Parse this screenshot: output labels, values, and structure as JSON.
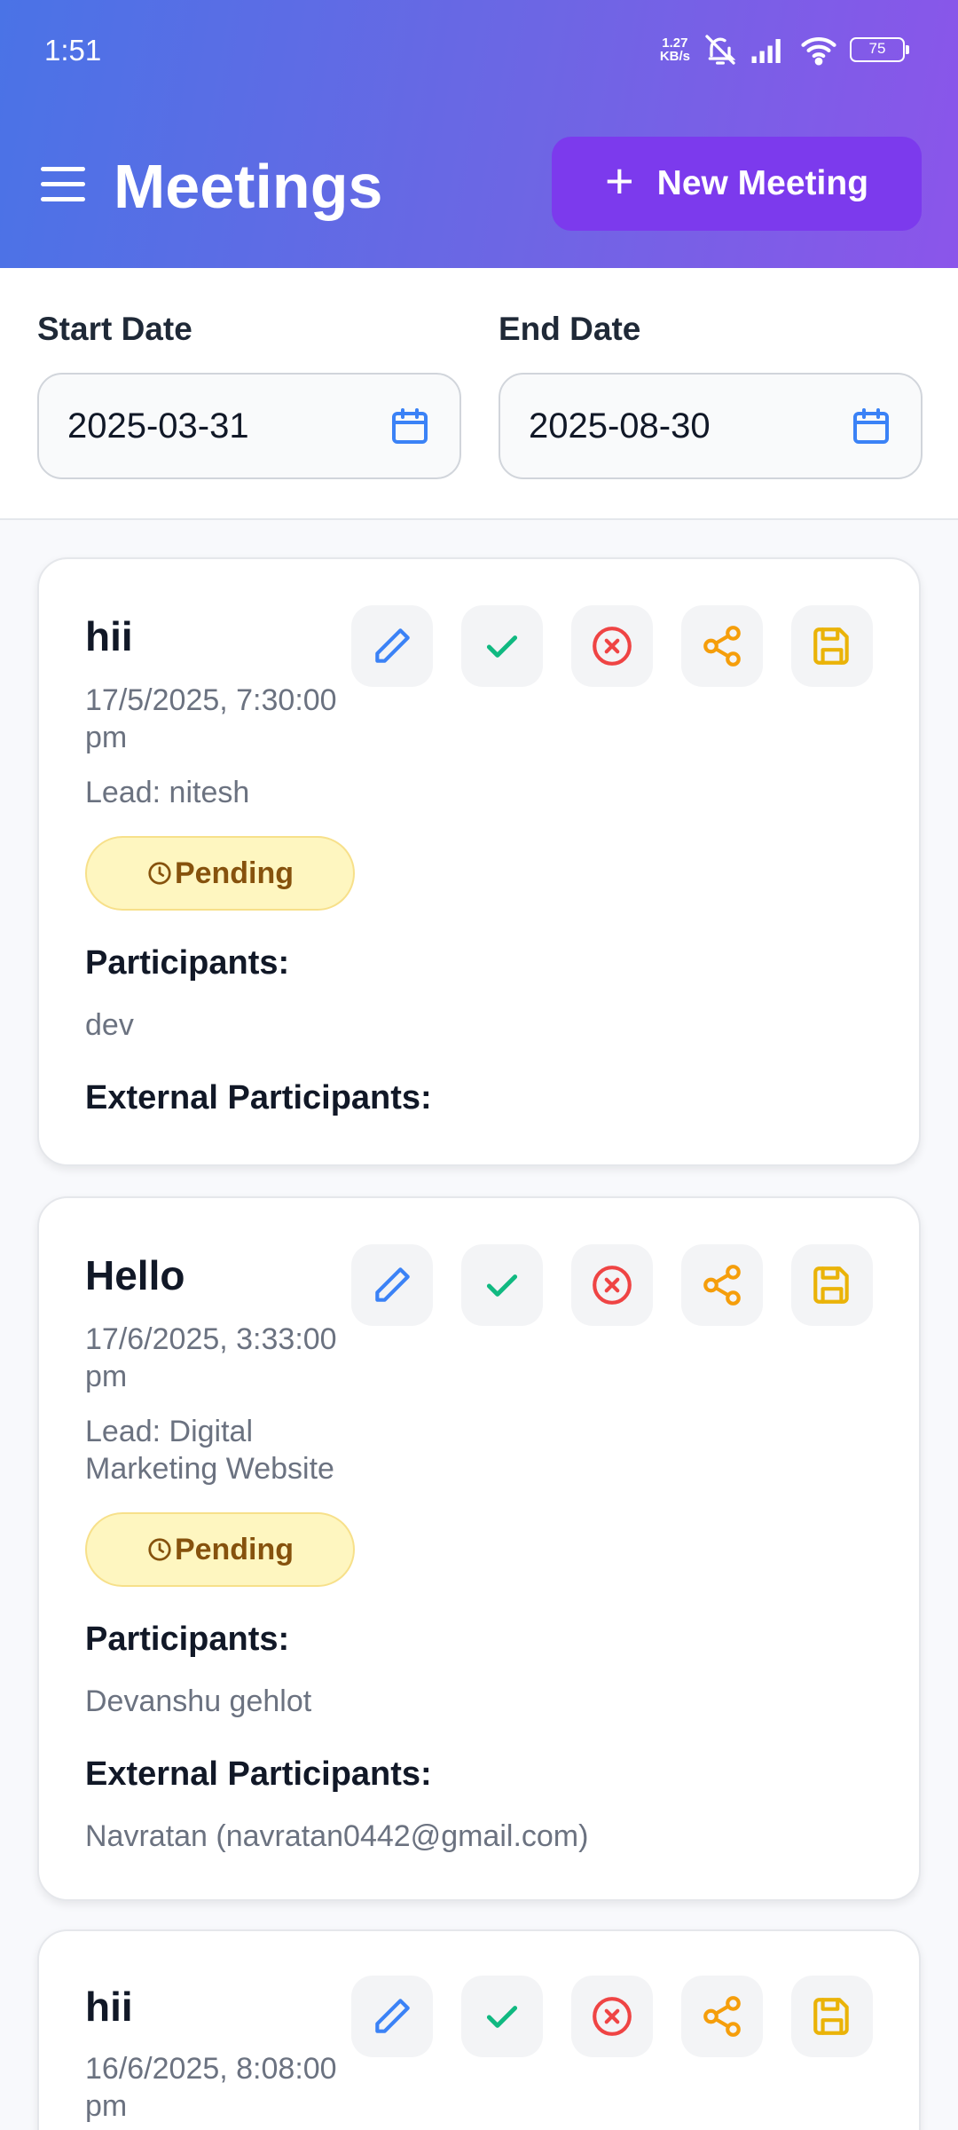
{
  "status_bar": {
    "time": "1:51",
    "net_speed_value": "1.27",
    "net_speed_unit": "KB/s",
    "battery": "75"
  },
  "header": {
    "title": "Meetings",
    "new_button_label": "New Meeting"
  },
  "filters": {
    "start": {
      "label": "Start Date",
      "value": "2025-03-31"
    },
    "end": {
      "label": "End Date",
      "value": "2025-08-30"
    }
  },
  "labels": {
    "participants": "Participants:",
    "external": "External Participants:"
  },
  "meetings": [
    {
      "title": "hii",
      "datetime": "17/5/2025, 7:30:00 pm",
      "lead": "Lead: nitesh",
      "status": "Pending",
      "participants": "dev",
      "external": ""
    },
    {
      "title": "Hello",
      "datetime": "17/6/2025, 3:33:00 pm",
      "lead": "Lead: Digital Marketing Website",
      "status": "Pending",
      "participants": "Devanshu gehlot",
      "external": "Navratan (navratan0442@gmail.com)"
    },
    {
      "title": "hii",
      "datetime": "16/6/2025, 8:08:00 pm"
    }
  ],
  "colors": {
    "edit": "#3b82f6",
    "confirm": "#10b981",
    "cancel": "#ef4444",
    "share": "#f59e0b",
    "save": "#eab308",
    "accent": "#7c3aed"
  }
}
